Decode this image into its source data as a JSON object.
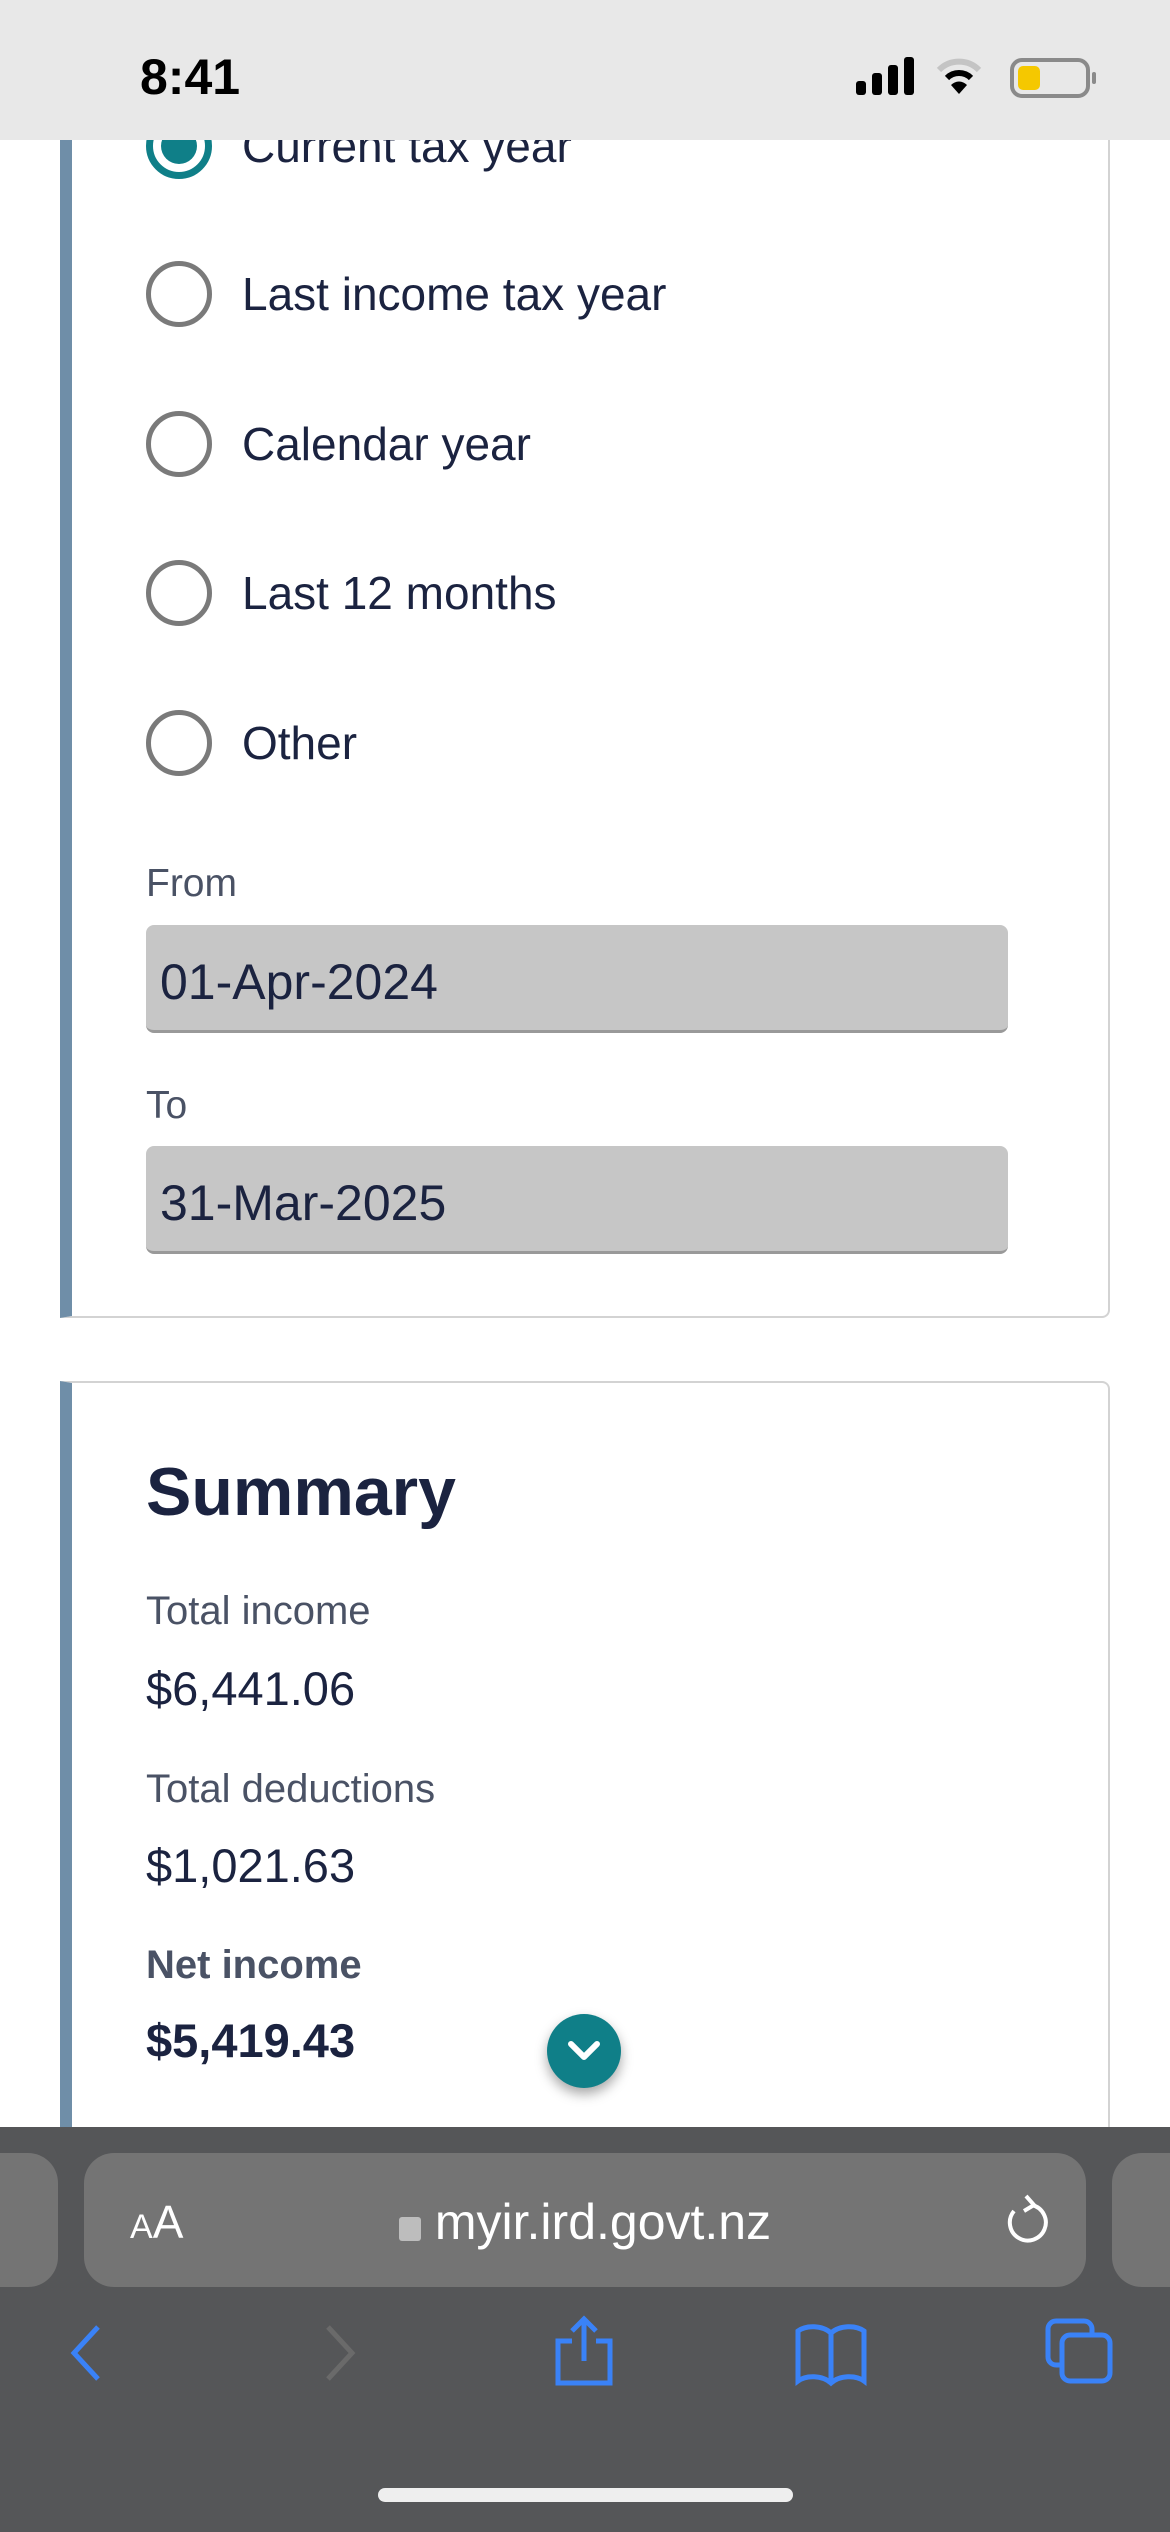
{
  "status_bar": {
    "time": "8:41",
    "battery_level_percent": 35,
    "battery_color": "#f5c800"
  },
  "period": {
    "options": [
      {
        "label": "Current tax year",
        "selected": true
      },
      {
        "label": "Last income tax year",
        "selected": false
      },
      {
        "label": "Calendar year",
        "selected": false
      },
      {
        "label": "Last 12 months",
        "selected": false
      },
      {
        "label": "Other",
        "selected": false
      }
    ],
    "from_label": "From",
    "from_value": "01-Apr-2024",
    "to_label": "To",
    "to_value": "31-Mar-2025"
  },
  "summary": {
    "title": "Summary",
    "total_income_label": "Total income",
    "total_income": "$6,441.06",
    "total_deductions_label": "Total deductions",
    "total_deductions": "$1,021.63",
    "net_income_label": "Net income",
    "net_income": "$5,419.43"
  },
  "browser": {
    "text_size_label_small": "A",
    "text_size_label_large": "A",
    "url": "myir.ird.govt.nz",
    "accent": "#3a82f7"
  },
  "colors": {
    "accent": "#0f7f88",
    "card_border": "#6f8ea8"
  }
}
